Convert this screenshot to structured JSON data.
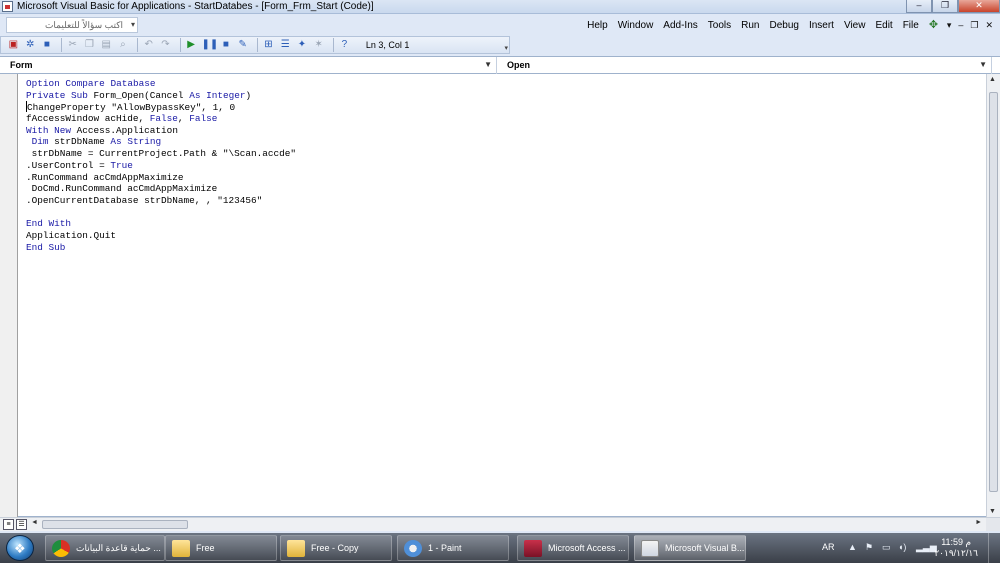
{
  "window": {
    "title": "Microsoft Visual Basic for Applications - StartDatabes - [Form_Frm_Start (Code)]",
    "minimize_glyph": "–",
    "restore_glyph": "❐",
    "close_glyph": "✕"
  },
  "ask_box": {
    "placeholder": "اكتب سؤالاً للتعليمات"
  },
  "menu": {
    "items": [
      {
        "label": "Help"
      },
      {
        "label": "Window"
      },
      {
        "label": "Add-Ins"
      },
      {
        "label": "Tools"
      },
      {
        "label": "Run"
      },
      {
        "label": "Debug"
      },
      {
        "label": "Insert"
      },
      {
        "label": "View"
      },
      {
        "label": "Edit"
      },
      {
        "label": "File"
      }
    ],
    "child_controls": [
      "▾",
      "–",
      "❐",
      "✕"
    ]
  },
  "toolbar": {
    "cursor_position": "Ln 3, Col 1"
  },
  "code_window": {
    "object_dropdown": "Form",
    "procedure_dropdown": "Open"
  },
  "code_lines": [
    "Option Compare Database",
    "Private Sub Form_Open(Cancel As Integer)",
    "ChangeProperty \"AllowBypassKey\", 1, 0",
    "fAccessWindow acHide, False, False",
    "With New Access.Application",
    " Dim strDbName As String",
    " strDbName = CurrentProject.Path & \"\\Scan.accde\"",
    ".UserControl = True",
    ".RunCommand acCmdAppMaximize",
    " DoCmd.RunCommand acCmdAppMaximize",
    ".OpenCurrentDatabase strDbName, , \"123456\"",
    "",
    "End With",
    "Application.Quit",
    "End Sub"
  ],
  "taskbar": {
    "tasks": [
      {
        "label": "حماية قاعدة البيانات ...",
        "icon": "chrome-icon"
      },
      {
        "label": "Free",
        "icon": "folder-icon"
      },
      {
        "label": "Free - Copy",
        "icon": "folder-icon"
      },
      {
        "label": "1 - Paint",
        "icon": "paint-icon"
      },
      {
        "label": "Microsoft Access ...",
        "icon": "access-icon"
      },
      {
        "label": "Microsoft Visual B...",
        "icon": "vba-icon"
      }
    ],
    "language": "AR",
    "time": "11:59 م",
    "date": "٢٠١٩/١٢/١٦"
  }
}
